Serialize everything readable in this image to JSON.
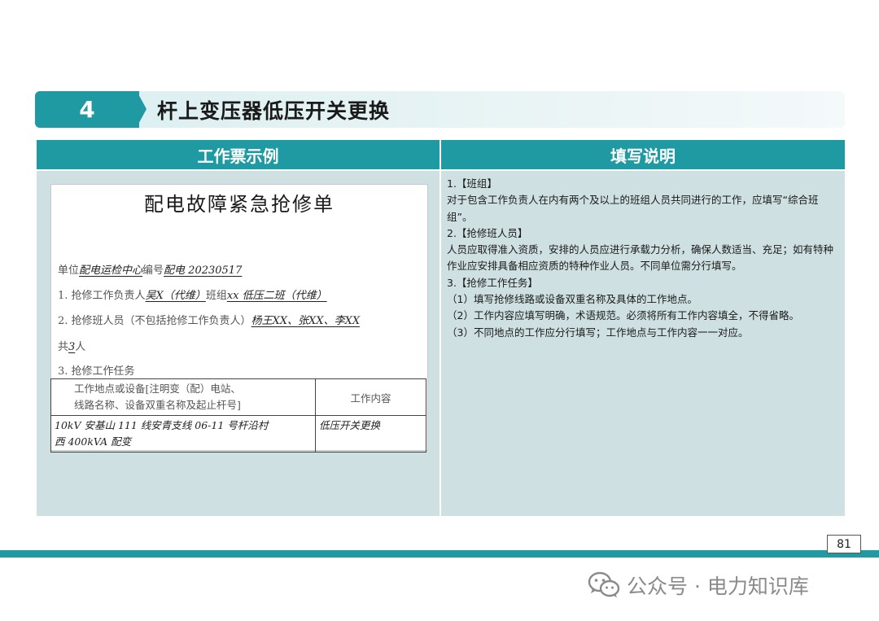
{
  "slide": {
    "number": "4",
    "title": "杆上变压器低压开关更换",
    "page_number": "81"
  },
  "columns": {
    "left_header": "工作票示例",
    "right_header": "填写说明"
  },
  "form": {
    "title": "配电故障紧急抢修单",
    "unit_label": "单位",
    "unit_value": "配电运检中心",
    "number_label": "编号",
    "number_value": "配电 20230517",
    "line1_label": "1. 抢修工作负责人",
    "line1_leader": "吴X（代维）",
    "line1_team_label": "班组",
    "line1_team": "xx 低压二班（代维）",
    "line2_label": "2. 抢修班人员（不包括抢修工作负责人）",
    "line2_members": "杨王XX、张XX、李XX",
    "line2b_pre": "共",
    "line2b_count": "3",
    "line2b_post": "人",
    "line3_label": "3. 抢修工作任务",
    "table_head_col1_line1": "工作地点或设备[注明变（配）电站、",
    "table_head_col1_line2": "线路名称、设备双重名称及起止杆号]",
    "table_head_col2": "工作内容",
    "table_row_col1_line1": "10kV 安基山 111 线安青支线 06-11 号杆沿村",
    "table_row_col1_line2": "西 400kVA 配变",
    "table_row_col2": "低压开关更换"
  },
  "instructions": [
    "1.【班组】",
    "对于包含工作负责人在内有两个及以上的班组人员共同进行的工作，应填写“综合班组”。",
    "2.【抢修班人员】",
    "人员应取得准入资质，安排的人员应进行承载力分析，确保人数适当、充足；如有特种作业应安排具备相应资质的特种作业人员。不同单位需分行填写。",
    "3.【抢修工作任务】",
    "（1）填写抢修线路或设备双重名称及具体的工作地点。",
    "（2）工作内容应填写明确，术语规范。必须将所有工作内容填全，不得省略。",
    "（3）不同地点的工作应分行填写；工作地点与工作内容一一对应。"
  ],
  "watermark": {
    "icon": "wechat-icon",
    "text": "公众号 · 电力知识库"
  },
  "colors": {
    "accent": "#1f9aa3",
    "panel": "#cfe0e2"
  }
}
